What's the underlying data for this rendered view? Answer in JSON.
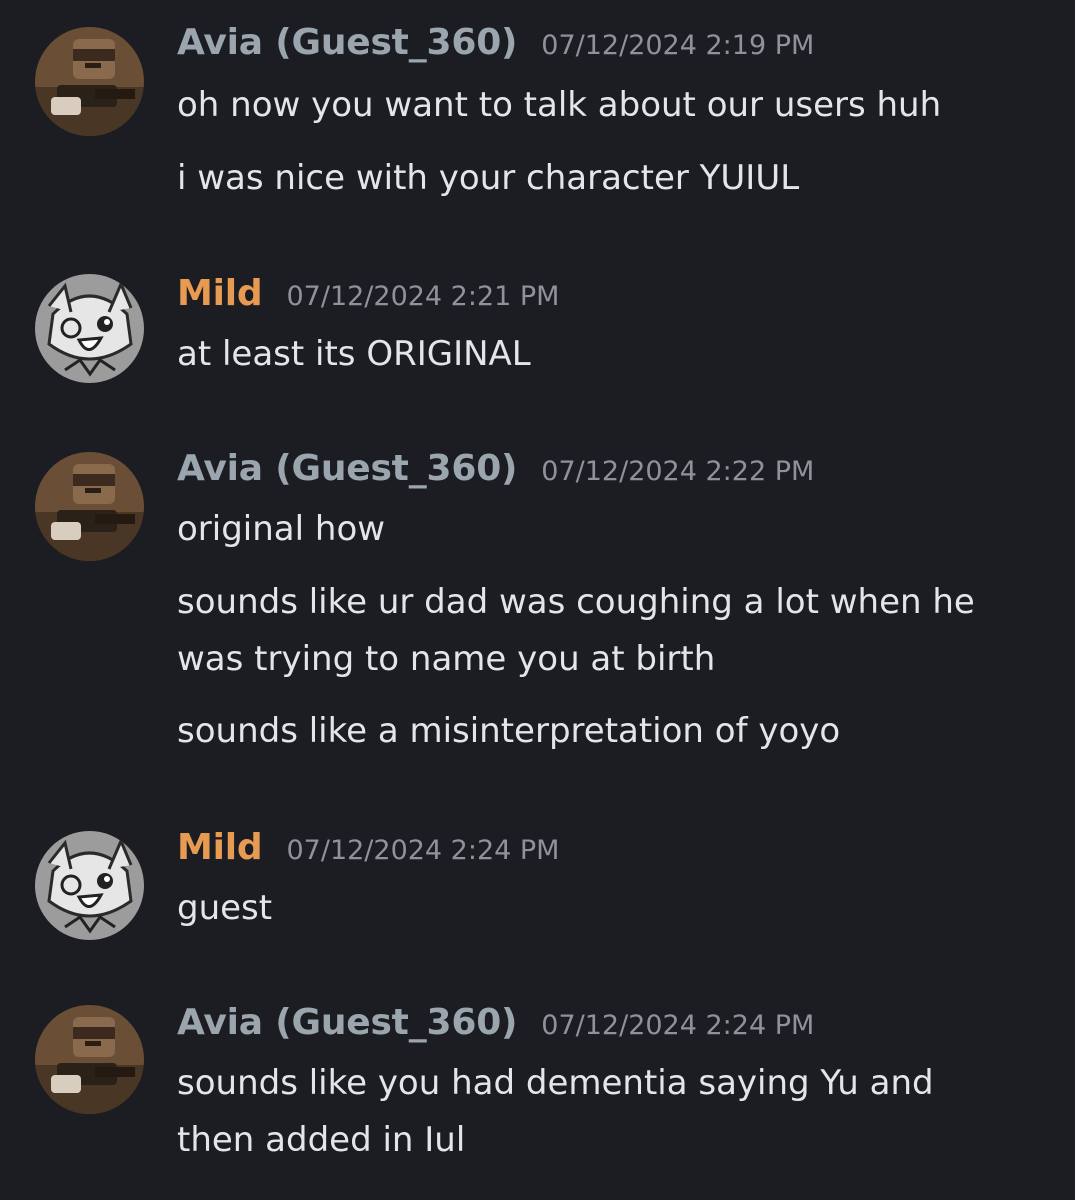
{
  "messages": [
    {
      "author": "Avia (Guest_360)",
      "timestamp": "07/12/2024 2:19 PM",
      "avatar_icon": "roblox-character-avatar-icon",
      "lines": [
        [
          "oh now you want to talk about our users huh"
        ],
        [
          "i was nice with your character YUIUL"
        ]
      ]
    },
    {
      "author": "Mild",
      "timestamp": "07/12/2024 2:21 PM",
      "avatar_icon": "sketch-face-avatar-icon",
      "lines": [
        [
          "at least its ORIGINAL"
        ]
      ]
    },
    {
      "author": "Avia (Guest_360)",
      "timestamp": "07/12/2024 2:22 PM",
      "avatar_icon": "roblox-character-avatar-icon",
      "lines": [
        [
          "original how"
        ],
        [
          "sounds like ur dad was coughing a lot when he",
          "was trying to name you at birth"
        ],
        [
          "sounds like a misinterpretation of yoyo"
        ]
      ]
    },
    {
      "author": "Mild",
      "timestamp": "07/12/2024 2:24 PM",
      "avatar_icon": "sketch-face-avatar-icon",
      "lines": [
        [
          "guest"
        ]
      ]
    },
    {
      "author": "Avia (Guest_360)",
      "timestamp": "07/12/2024 2:24 PM",
      "avatar_icon": "roblox-character-avatar-icon",
      "lines": [
        [
          "sounds like you had dementia saying Yu and",
          "then added in Iul"
        ]
      ]
    }
  ],
  "colors": {
    "background": "#1c1d22",
    "text": "#e4e5e9",
    "timestamp": "#8f929b",
    "username_avia": "#9aa5ad",
    "username_mild": "#e69a52"
  }
}
